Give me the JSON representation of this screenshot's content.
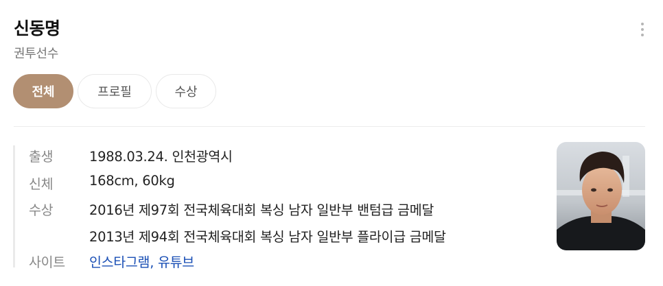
{
  "profile": {
    "name": "신동명",
    "occupation": "권투선수"
  },
  "tabs": [
    {
      "label": "전체",
      "active": true
    },
    {
      "label": "프로필",
      "active": false
    },
    {
      "label": "수상",
      "active": false
    }
  ],
  "info": {
    "birth": {
      "label": "출생",
      "value": "1988.03.24. 인천광역시"
    },
    "body": {
      "label": "신체",
      "value": "168cm, 60kg"
    },
    "awards": {
      "label": "수상",
      "items": [
        "2016년 제97회 전국체육대회 복싱 남자 일반부 밴텀급 금메달",
        "2013년 제94회 전국체육대회 복싱 남자 일반부 플라이급 금메달"
      ]
    },
    "site": {
      "label": "사이트",
      "links": [
        "인스타그램",
        "유튜브"
      ],
      "separator": ", "
    }
  },
  "colors": {
    "accent": "#b28f72",
    "link": "#1a4fb5",
    "label": "#888888"
  },
  "icons": {
    "more": "more-vertical-icon"
  }
}
